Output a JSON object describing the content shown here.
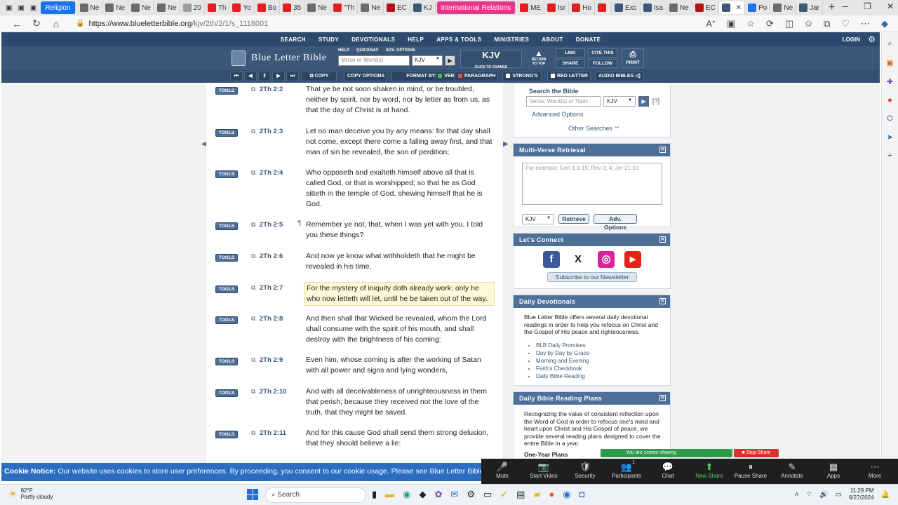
{
  "browser": {
    "tabs": [
      {
        "label": "Religion",
        "type": "group",
        "color": "#1a73e8"
      },
      {
        "label": "Ne",
        "fav": "#6b6b6b"
      },
      {
        "label": "Ne",
        "fav": "#6b6b6b"
      },
      {
        "label": "Ne",
        "fav": "#6b6b6b"
      },
      {
        "label": "Ne",
        "fav": "#6b6b6b"
      },
      {
        "label": "20",
        "fav": "#9e9e9e"
      },
      {
        "label": "Th",
        "fav": "#e02020"
      },
      {
        "label": "Yo",
        "fav": "#e02020"
      },
      {
        "label": "Bo",
        "fav": "#e02020"
      },
      {
        "label": "35",
        "fav": "#e02020"
      },
      {
        "label": "Ne",
        "fav": "#6b6b6b"
      },
      {
        "label": "\"Th",
        "fav": "#e02020"
      },
      {
        "label": "Ne",
        "fav": "#6b6b6b"
      },
      {
        "label": "EC",
        "fav": "#b3121b"
      },
      {
        "label": "KJ",
        "fav": "#3b5878"
      },
      {
        "label": "International Relations",
        "type": "group",
        "color": "#e8348a"
      },
      {
        "label": "ME",
        "fav": "#e02020"
      },
      {
        "label": "Isr",
        "fav": "#e02020"
      },
      {
        "label": "Ho",
        "fav": "#e02020"
      },
      {
        "label": "",
        "fav": "#e02020"
      },
      {
        "label": "Exc",
        "fav": "#3b5878"
      },
      {
        "label": "Isa",
        "fav": "#3b5878"
      },
      {
        "label": "Ne",
        "fav": "#6b6b6b"
      },
      {
        "label": "EC",
        "fav": "#b3121b"
      },
      {
        "label": "",
        "fav": "#3b5878",
        "active": true
      },
      {
        "label": "Po",
        "fav": "#1a73e8"
      },
      {
        "label": "Ne",
        "fav": "#6b6b6b"
      },
      {
        "label": "Jar",
        "fav": "#3b5878"
      }
    ],
    "url_host": "https://www.blueletterbible.org",
    "url_path": "/kjv/2th/2/1/s_1118001"
  },
  "blb": {
    "top_nav": [
      "SEARCH",
      "STUDY",
      "DEVOTIONALS",
      "HELP",
      "APPS & TOOLS",
      "MINISTRIES",
      "ABOUT",
      "DONATE"
    ],
    "login": "LOGIN",
    "logo": "Blue Letter Bible",
    "mini_links": [
      "HELP",
      "QUICKNAV",
      "ADV. OPTIONS"
    ],
    "search_placeholder": "Verse or Word(s)",
    "version": "KJV",
    "kjv_big": "KJV",
    "kjv_small": "CLICK TO CHANGE",
    "return_top": [
      "RETURN",
      "TO TOP"
    ],
    "link": "LINK",
    "share": "SHARE",
    "cite": "CITE THIS",
    "follow": "FOLLOW",
    "print": "PRINT",
    "toolbar": {
      "copy": "COPY",
      "copy_options": "COPY OPTIONS",
      "format_by": "FORMAT BY:",
      "verse": "VERSE",
      "paragraph": "PARAGRAPH",
      "strongs": "STRONG'S",
      "red_letter": "RED LETTER",
      "audio": "AUDIO BIBLES"
    }
  },
  "verses": [
    {
      "tools": "TOOLS",
      "ref": "2Th 2:2",
      "text": "That ye be not soon shaken in mind, or be troubled, neither by spirit, nor by word, nor by letter as from us, as that the day of Christ is at hand."
    },
    {
      "tools": "TOOLS",
      "ref": "2Th 2:3",
      "text": "Let no man deceive you by any means: for that day shall not come, except there come a falling away first, and that man of sin be revealed, the son of perdition;"
    },
    {
      "tools": "TOOLS",
      "ref": "2Th 2:4",
      "text": "Who opposeth and exalteth himself above all that is called God, or that is worshipped; so that he as God sitteth in the temple of God, shewing himself that he is God."
    },
    {
      "tools": "TOOLS",
      "ref": "2Th 2:5",
      "text": "Remember ye not, that, when I was yet with you, I told you these things?",
      "para": "¶"
    },
    {
      "tools": "TOOLS",
      "ref": "2Th 2:6",
      "text": "And now ye know what withholdeth that he might be revealed in his time."
    },
    {
      "tools": "TOOLS",
      "ref": "2Th 2:7",
      "text": "For the mystery of iniquity doth already work: only he who now letteth will let, until he be taken out of the way."
    },
    {
      "tools": "TOOLS",
      "ref": "2Th 2:8",
      "text": "And then shall that Wicked be revealed, whom the Lord shall consume with the spirit of his mouth, and shall destroy with the brightness of his coming:"
    },
    {
      "tools": "TOOLS",
      "ref": "2Th 2:9",
      "text": "Even him, whose coming is after the working of Satan with all power and signs and lying wonders,"
    },
    {
      "tools": "TOOLS",
      "ref": "2Th 2:10",
      "text": "And with all deceivableness of unrighteousness in them that perish; because they received not the love of the truth, that they might be saved."
    },
    {
      "tools": "TOOLS",
      "ref": "2Th 2:11",
      "text": "And for this cause God shall send them strong delusion, that they should believe a lie:"
    }
  ],
  "search_panel": {
    "title": "Search the Bible",
    "placeholder": "Verse, Word(s) or Topic",
    "version": "KJV",
    "help": "[?]",
    "advanced": "Advanced Options",
    "other": "Other Searches"
  },
  "multi_verse": {
    "title": "Multi-Verse Retrieval",
    "placeholder": "For example: Gen 1:1-15; Rev 3; 4; Jer 21:10",
    "version": "KJV",
    "retrieve": "Retrieve",
    "adv": "Adv. Options"
  },
  "connect": {
    "title": "Let's Connect",
    "icons": [
      "f",
      "X",
      "◎",
      "▶"
    ],
    "newsletter": "Subscribe to our Newsletter"
  },
  "devotionals": {
    "title": "Daily Devotionals",
    "text": "Blue Letter Bible offers several daily devotional readings in order to help you refocus on Christ and the Gospel of His peace and righteousness.",
    "items": [
      "BLB Daily Promises",
      "Day by Day by Grace",
      "Morning and Evening",
      "Faith's Checkbook",
      "Daily Bible Reading"
    ]
  },
  "reading_plans": {
    "title": "Daily Bible Reading Plans",
    "text": "Recognizing the value of consistent reflection upon the Word of God in order to refocus one's mind and heart upon Christ and His Gospel of peace, we provide several reading plans designed to cover the entire Bible in a year.",
    "subhead": "One-Year Plans"
  },
  "cookie": {
    "label": "Cookie Notice:",
    "text": "Our website uses cookies to store user preferences. By proceeding, you consent to our cookie usage. Please see Blue Letter Bible's"
  },
  "zoom": {
    "sharing": "You are screen sharing",
    "stop": "Stop Share",
    "count": "1",
    "items": [
      "Mute",
      "Start Video",
      "Security",
      "Participants",
      "Chat",
      "New Share",
      "Pause Share",
      "Annotate",
      "Apps",
      "More"
    ]
  },
  "taskbar": {
    "temp": "82°F",
    "weather": "Partly cloudy",
    "search": "Search",
    "time": "11:29 PM",
    "date": "6/27/2024"
  }
}
